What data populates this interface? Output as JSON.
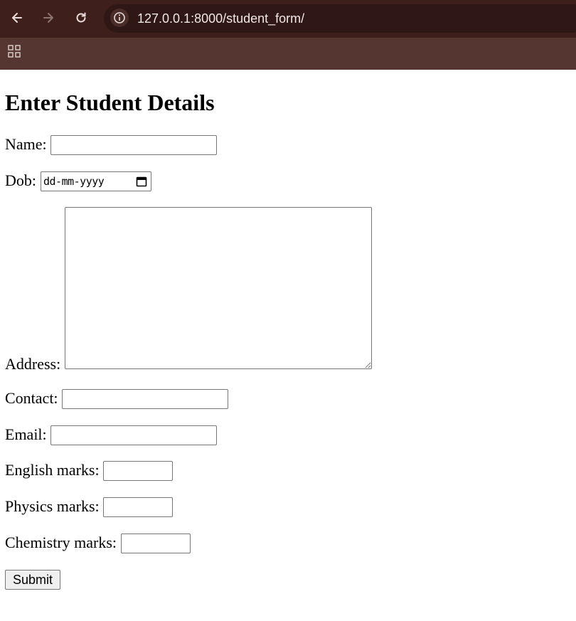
{
  "browser": {
    "url": "127.0.0.1:8000/student_form/",
    "icons": {
      "back": "back-arrow-icon",
      "forward": "forward-arrow-icon",
      "reload": "reload-icon",
      "site_info": "info-icon",
      "apps": "apps-grid-icon"
    }
  },
  "form": {
    "title": "Enter Student Details",
    "name_label": "Name:",
    "dob_label": "Dob:",
    "dob_placeholder": "dd-mm-yyyy",
    "address_label": "Address:",
    "contact_label": "Contact:",
    "email_label": "Email:",
    "english_label": "English marks:",
    "physics_label": "Physics marks:",
    "chemistry_label": "Chemistry marks:",
    "submit_label": "Submit",
    "values": {
      "name": "",
      "address": "",
      "contact": "",
      "email": "",
      "english": "",
      "physics": "",
      "chemistry": ""
    }
  },
  "colors": {
    "toolbar": "#3f1f1c",
    "bookmarks_bar": "#563631",
    "omnibox": "#2e1714"
  }
}
